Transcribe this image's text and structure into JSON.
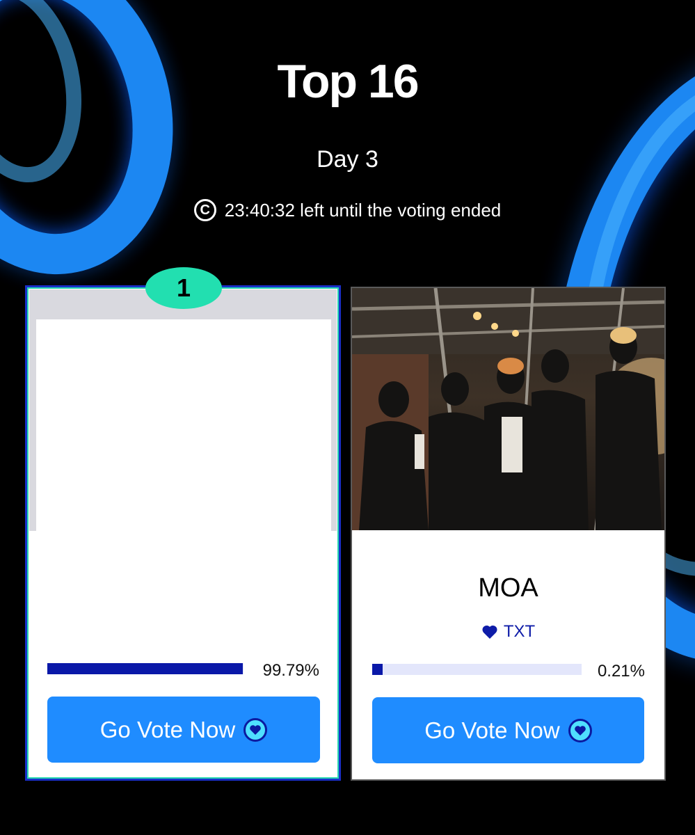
{
  "header": {
    "title": "Top 16",
    "subtitle": "Day 3",
    "timer_text": "23:40:32 left until the voting ended",
    "timer_icon": "clock-c-icon"
  },
  "colors": {
    "background": "#000000",
    "accent_blue": "#1f8cff",
    "progress_fill": "#0a18a8",
    "rank_badge": "#22dfb0"
  },
  "cards": [
    {
      "rank": "1",
      "name": "",
      "tag": "",
      "progress_fraction": 0.9979,
      "percent_label": "99.79%",
      "button_label": "Go Vote Now",
      "button_icon": "vote-heart-icon"
    },
    {
      "rank": "",
      "name": "MOA",
      "tag": "TXT",
      "tag_icon": "heart-icon",
      "progress_fraction": 0.0021,
      "percent_label": "0.21%",
      "button_label": "Go Vote Now",
      "button_icon": "vote-heart-icon"
    }
  ]
}
